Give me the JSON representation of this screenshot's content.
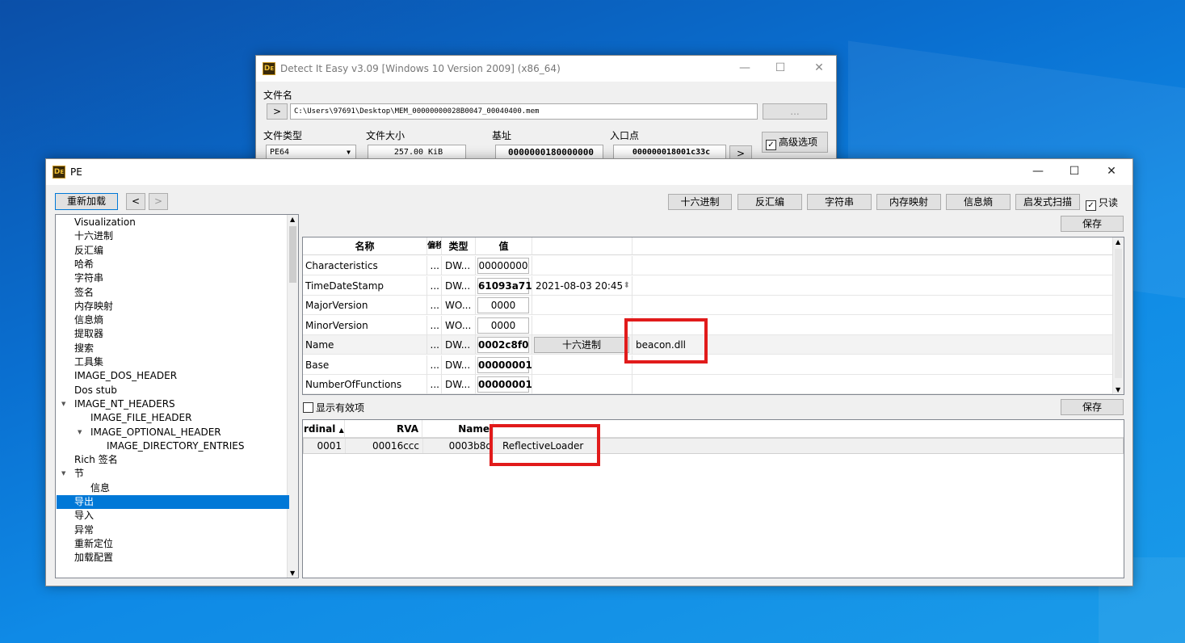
{
  "die_window": {
    "title": "Detect It Easy v3.09 [Windows 10 Version 2009] (x86_64)",
    "icon": "die-icon",
    "filename_label": "文件名",
    "path_button": ">",
    "file_path": "C:\\Users\\97691\\Desktop\\MEM_00000000028B0047_00040400.mem",
    "browse_button": "...",
    "filetype_label": "文件类型",
    "filetype_value": "PE64",
    "filesize_label": "文件大小",
    "filesize_value": "257.00 KiB",
    "base_label": "基址",
    "base_value": "0000000180000000",
    "entry_label": "入口点",
    "entry_value": "000000018001c33c",
    "entry_button": ">",
    "advanced_label": "高级选项",
    "advanced_checked": "✓"
  },
  "pe_window": {
    "title": "PE",
    "icon": "die-icon",
    "reload_button": "重新加载",
    "back_button": "<",
    "forward_button": ">",
    "toolbar": [
      "十六进制",
      "反汇编",
      "字符串",
      "内存映射",
      "信息熵",
      "启发式扫描"
    ],
    "readonly_label": "只读",
    "readonly_checked": "✓",
    "save_label": "保存",
    "save_label_2": "保存",
    "show_valid_label": "显示有效项"
  },
  "tree": {
    "items": [
      {
        "label": "Visualization",
        "indent": 0
      },
      {
        "label": "十六进制",
        "indent": 0
      },
      {
        "label": "反汇编",
        "indent": 0
      },
      {
        "label": "哈希",
        "indent": 0
      },
      {
        "label": "字符串",
        "indent": 0
      },
      {
        "label": "签名",
        "indent": 0
      },
      {
        "label": "内存映射",
        "indent": 0
      },
      {
        "label": "信息熵",
        "indent": 0
      },
      {
        "label": "提取器",
        "indent": 0
      },
      {
        "label": "搜索",
        "indent": 0
      },
      {
        "label": "工具集",
        "indent": 0
      },
      {
        "label": "IMAGE_DOS_HEADER",
        "indent": 0
      },
      {
        "label": "Dos stub",
        "indent": 0
      },
      {
        "label": "IMAGE_NT_HEADERS",
        "indent": 0,
        "expanded": true
      },
      {
        "label": "IMAGE_FILE_HEADER",
        "indent": 1
      },
      {
        "label": "IMAGE_OPTIONAL_HEADER",
        "indent": 1,
        "expanded": true
      },
      {
        "label": "IMAGE_DIRECTORY_ENTRIES",
        "indent": 2
      },
      {
        "label": "Rich 签名",
        "indent": 0
      },
      {
        "label": "节",
        "indent": 0,
        "expanded": true
      },
      {
        "label": "信息",
        "indent": 1
      },
      {
        "label": "导出",
        "indent": 0,
        "selected": true
      },
      {
        "label": "导入",
        "indent": 0
      },
      {
        "label": "异常",
        "indent": 0
      },
      {
        "label": "重新定位",
        "indent": 0
      },
      {
        "label": "加载配置",
        "indent": 0
      }
    ]
  },
  "export_table": {
    "headers": [
      "名称",
      "偏移",
      "类型",
      "值"
    ],
    "rows": [
      {
        "name": "Characteristics",
        "offset": "...",
        "type": "DW...",
        "value": "00000000",
        "bold": false,
        "extra": "",
        "extra2": ""
      },
      {
        "name": "TimeDateStamp",
        "offset": "...",
        "type": "DW...",
        "value": "61093a71",
        "bold": true,
        "extra": "2021-08-03 20:45",
        "extra2": ""
      },
      {
        "name": "MajorVersion",
        "offset": "...",
        "type": "WO...",
        "value": "0000",
        "bold": false,
        "extra": "",
        "extra2": ""
      },
      {
        "name": "MinorVersion",
        "offset": "...",
        "type": "WO...",
        "value": "0000",
        "bold": false,
        "extra": "",
        "extra2": ""
      },
      {
        "name": "Name",
        "offset": "...",
        "type": "DW...",
        "value": "0002c8f0",
        "bold": true,
        "extra": "十六进制",
        "extra2": "beacon.dll"
      },
      {
        "name": "Base",
        "offset": "...",
        "type": "DW...",
        "value": "00000001",
        "bold": true,
        "extra": "",
        "extra2": ""
      },
      {
        "name": "NumberOfFunctions",
        "offset": "...",
        "type": "DW...",
        "value": "00000001",
        "bold": true,
        "extra": "",
        "extra2": ""
      }
    ]
  },
  "functions_table": {
    "headers": [
      "rdinal",
      "RVA",
      "Name"
    ],
    "sort_indicator": "▲",
    "rows": [
      {
        "ordinal": "0001",
        "rva": "00016ccc",
        "name_rva": "0003b8d",
        "name": "ReflectiveLoader"
      }
    ]
  },
  "annotations": {
    "color": "#e11b1b"
  }
}
